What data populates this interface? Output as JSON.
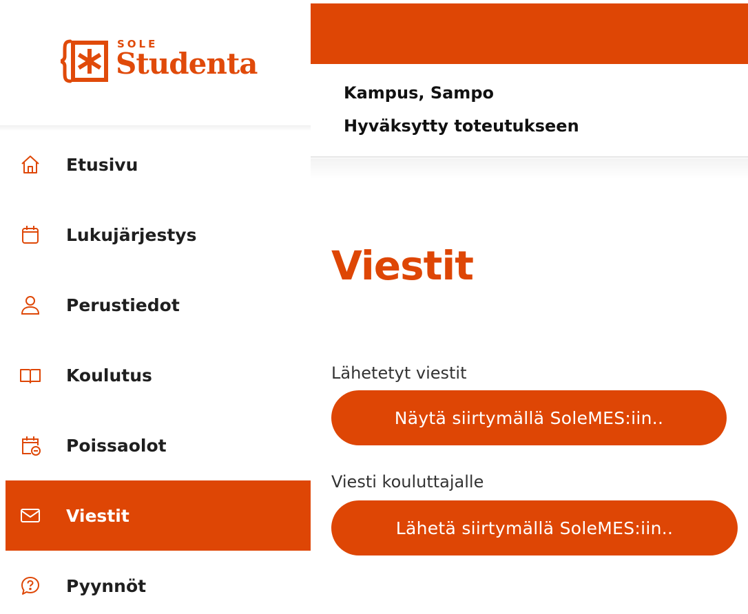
{
  "brand": {
    "sole": "SOLE",
    "name": "Studenta",
    "accent": "#de4605"
  },
  "sidebar": {
    "items": [
      {
        "label": "Etusivu",
        "icon": "home-icon",
        "active": false
      },
      {
        "label": "Lukujärjestys",
        "icon": "calendar-icon",
        "active": false
      },
      {
        "label": "Perustiedot",
        "icon": "person-icon",
        "active": false
      },
      {
        "label": "Koulutus",
        "icon": "book-icon",
        "active": false
      },
      {
        "label": "Poissaolot",
        "icon": "calendar-absence-icon",
        "active": false
      },
      {
        "label": "Viestit",
        "icon": "envelope-icon",
        "active": true
      },
      {
        "label": "Pyynnöt",
        "icon": "question-bubble-icon",
        "active": false
      }
    ]
  },
  "header": {
    "name": "Kampus, Sampo",
    "status": "Hyväksytty toteutukseen"
  },
  "main": {
    "title": "Viestit",
    "sent_label": "Lähetetyt viestit",
    "sent_button": "Näytä siirtymällä SoleMES:iin..",
    "message_label": "Viesti kouluttajalle",
    "message_button": "Lähetä siirtymällä SoleMES:iin.."
  }
}
